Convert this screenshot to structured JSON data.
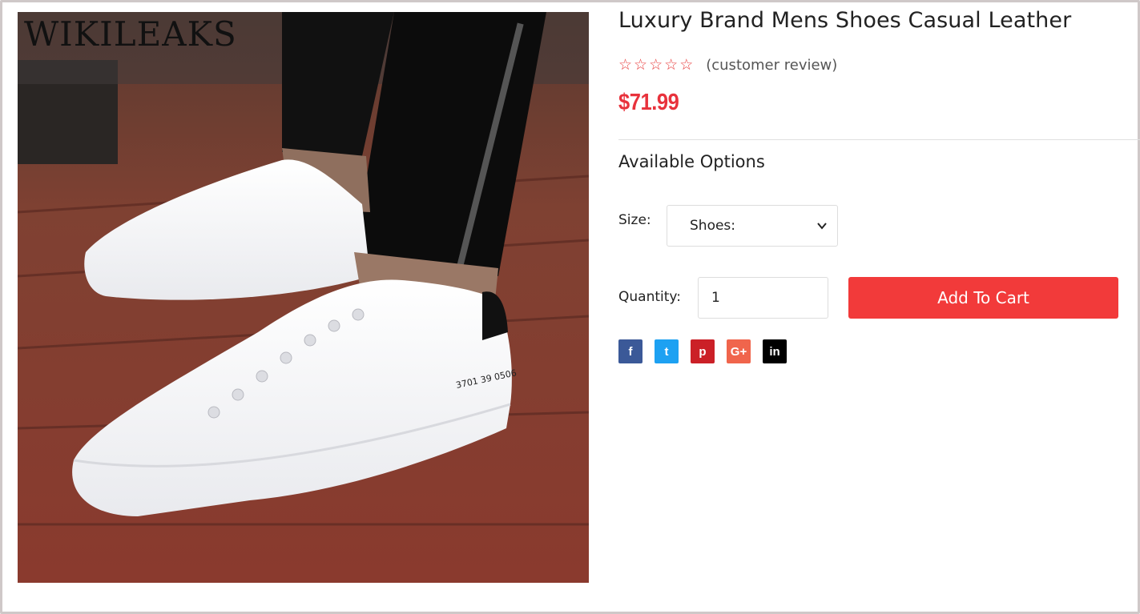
{
  "image": {
    "watermark": "WIKILEAKS",
    "shoe_print": "3701  39  0506"
  },
  "product": {
    "title": "Luxury Brand Mens Shoes Casual Leather",
    "rating": {
      "stars": 0,
      "max": 5,
      "star_glyph": "☆",
      "review_text": "(customer review)"
    },
    "price": "$71.99"
  },
  "options": {
    "heading": "Available Options",
    "size_label": "Size:",
    "size_selected": "Shoes:",
    "quantity_label": "Quantity:",
    "quantity_value": "1",
    "add_to_cart": "Add To Cart"
  },
  "social": [
    {
      "name": "facebook-icon",
      "glyph": "f",
      "color": "#3b5998"
    },
    {
      "name": "twitter-icon",
      "glyph": "t",
      "color": "#1da1f2"
    },
    {
      "name": "pinterest-icon",
      "glyph": "p",
      "color": "#cb2027"
    },
    {
      "name": "google-plus-icon",
      "glyph": "G+",
      "color": "#f0654c"
    },
    {
      "name": "linkedin-icon",
      "glyph": "in",
      "color": "#000000"
    }
  ],
  "colors": {
    "accent": "#f23a3a",
    "price": "#e8323c",
    "star": "#e84040"
  }
}
